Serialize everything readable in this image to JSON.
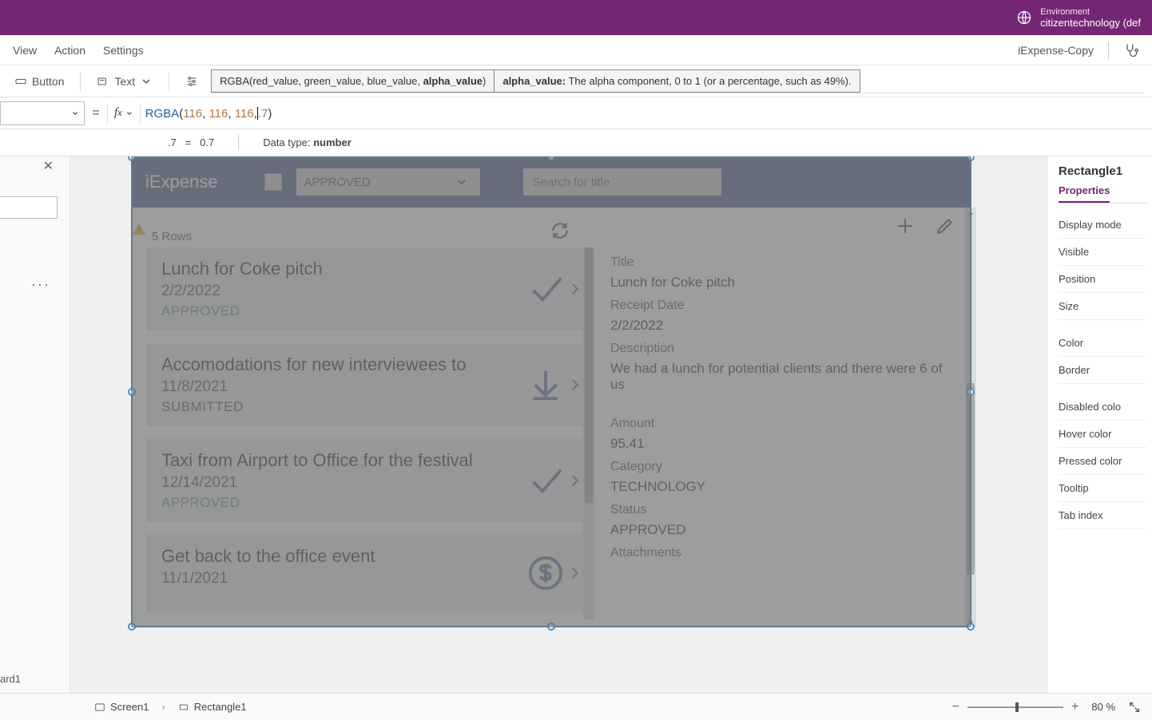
{
  "titlebar": {
    "env_label": "Environment",
    "env_value": "citizentechnology (def"
  },
  "menubar": {
    "items": [
      "View",
      "Action",
      "Settings"
    ],
    "project": "iExpense-Copy"
  },
  "toolbar": {
    "button": "Button",
    "text": "Text"
  },
  "formula_sig": {
    "sig_prefix": "RGBA(red_value, green_value, blue_value, ",
    "sig_bold": "alpha_value",
    "sig_suffix": ")",
    "param_name": "alpha_value:",
    "param_desc": " The alpha component, 0 to 1 (or a percentage, such as 49%)."
  },
  "formula_bar": {
    "fn": "RGBA",
    "open": "(",
    "n1": "116",
    "c1": ", ",
    "n2": "116",
    "c2": ", ",
    "n3": "116",
    "c3": ",",
    "n4": ".7",
    "close": ")"
  },
  "eval": {
    "expr": ".7",
    "eq": "=",
    "result": "0.7",
    "dt_label": "Data type: ",
    "dt_value": "number"
  },
  "leftpanel": {
    "ard": "ard1"
  },
  "app": {
    "title": "iExpense",
    "dropdown": "APPROVED",
    "search_placeholder": "Search for title",
    "rows_label": "5 Rows",
    "items": [
      {
        "title": "Lunch for Coke pitch",
        "date": "2/2/2022",
        "status": "APPROVED",
        "icon": "check"
      },
      {
        "title": "Accomodations for new interviewees to",
        "date": "11/8/2021",
        "status": "SUBMITTED",
        "icon": "download"
      },
      {
        "title": "Taxi from Airport to Office for the festival",
        "date": "12/14/2021",
        "status": "APPROVED",
        "icon": "check"
      },
      {
        "title": "Get back to the office event",
        "date": "11/1/2021",
        "status": "",
        "icon": "dollar"
      }
    ],
    "detail": {
      "title_label": "Title",
      "title_value": "Lunch for Coke pitch",
      "date_label": "Receipt Date",
      "date_value": "2/2/2022",
      "desc_label": "Description",
      "desc_value": "We had a lunch for potential clients and there were 6 of us",
      "amount_label": "Amount",
      "amount_value": "95.41",
      "category_label": "Category",
      "category_value": "TECHNOLOGY",
      "status_label": "Status",
      "status_value": "APPROVED",
      "attachments_label": "Attachments"
    }
  },
  "rightpanel": {
    "element": "Rectangle1",
    "tabs": [
      "Properties"
    ],
    "props": [
      "Display mode",
      "Visible",
      "Position",
      "Size",
      "",
      "Color",
      "Border",
      "",
      "Disabled colo",
      "Hover color",
      "Pressed color",
      "Tooltip",
      "Tab index"
    ]
  },
  "footer": {
    "crumb1": "Screen1",
    "crumb2": "Rectangle1",
    "zoom": "80",
    "pct": "%"
  }
}
